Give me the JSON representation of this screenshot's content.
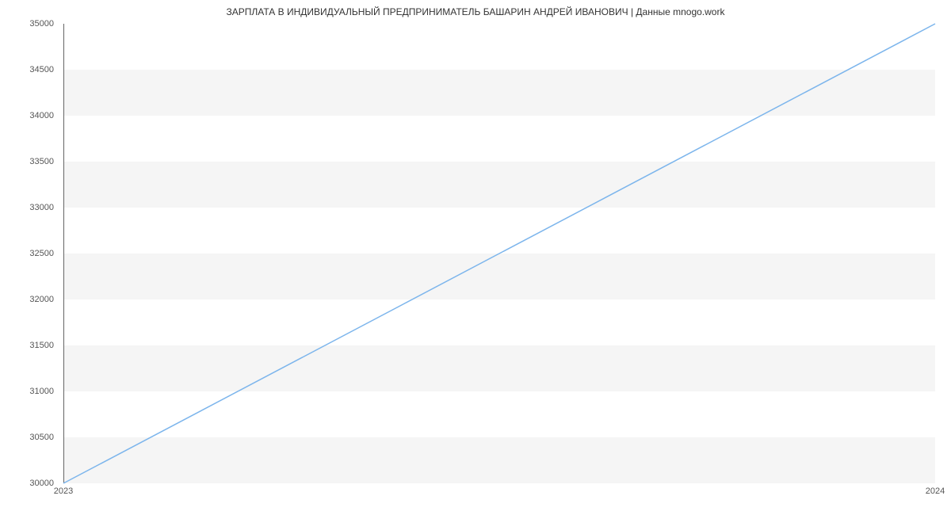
{
  "chart_data": {
    "type": "line",
    "title": "ЗАРПЛАТА В ИНДИВИДУАЛЬНЫЙ ПРЕДПРИНИМАТЕЛЬ БАШАРИН АНДРЕЙ ИВАНОВИЧ | Данные mnogo.work",
    "x": [
      2023,
      2024
    ],
    "values": [
      30000,
      35000
    ],
    "x_ticks": [
      2023,
      2024
    ],
    "y_ticks": [
      30000,
      30500,
      31000,
      31500,
      32000,
      32500,
      33000,
      33500,
      34000,
      34500,
      35000
    ],
    "xlim": [
      2023,
      2024
    ],
    "ylim": [
      30000,
      35000
    ],
    "xlabel": "",
    "ylabel": "",
    "line_color": "#7cb5ec"
  }
}
